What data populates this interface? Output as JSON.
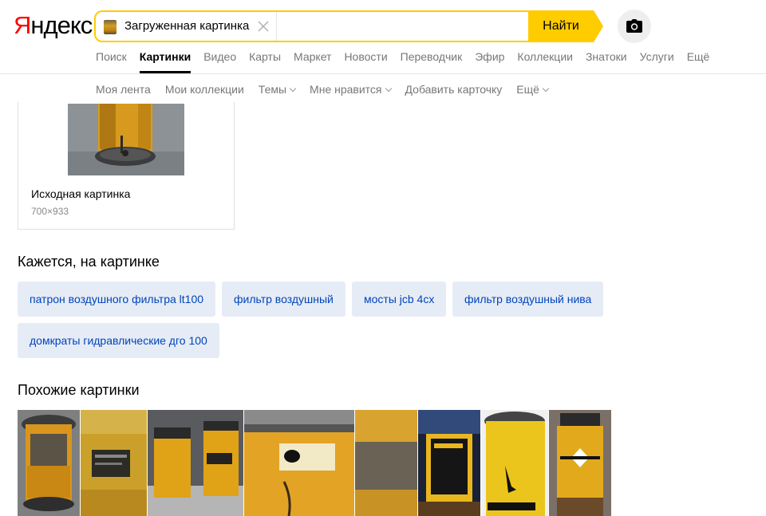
{
  "header": {
    "logo_first": "Я",
    "logo_rest": "ндекс",
    "search_chip": "Загруженная картинка",
    "search_placeholder": "",
    "find_button": "Найти"
  },
  "nav": {
    "tabs": [
      {
        "label": "Поиск",
        "active": false
      },
      {
        "label": "Картинки",
        "active": true
      },
      {
        "label": "Видео",
        "active": false
      },
      {
        "label": "Карты",
        "active": false
      },
      {
        "label": "Маркет",
        "active": false
      },
      {
        "label": "Новости",
        "active": false
      },
      {
        "label": "Переводчик",
        "active": false
      },
      {
        "label": "Эфир",
        "active": false
      },
      {
        "label": "Коллекции",
        "active": false
      },
      {
        "label": "Знатоки",
        "active": false
      },
      {
        "label": "Услуги",
        "active": false
      },
      {
        "label": "Ещё",
        "active": false
      }
    ]
  },
  "subnav": {
    "items": [
      {
        "label": "Моя лента",
        "dropdown": false
      },
      {
        "label": "Мои коллекции",
        "dropdown": false
      },
      {
        "label": "Темы",
        "dropdown": true
      },
      {
        "label": "Мне нравится",
        "dropdown": true
      },
      {
        "label": "Добавить карточку",
        "dropdown": false
      },
      {
        "label": "Ещё",
        "dropdown": true
      }
    ]
  },
  "original": {
    "title": "Исходная картинка",
    "size": "700×933"
  },
  "tags_section": {
    "title": "Кажется, на картинке",
    "tags": [
      "патрон воздушного фильтра lt100",
      "фильтр воздушный",
      "мосты jcb 4cx",
      "фильтр воздушный нива",
      "домкраты гидравлические дго 100"
    ]
  },
  "similar_section": {
    "title": "Похожие картинки",
    "images": [
      {
        "icon": "filter-yellow"
      },
      {
        "icon": "filter-label"
      },
      {
        "icon": "filter-pair"
      },
      {
        "icon": "filter-closeup"
      },
      {
        "icon": "filter-worn"
      },
      {
        "icon": "filter-dewalt"
      },
      {
        "icon": "filter-emu"
      },
      {
        "icon": "filter-cedima"
      }
    ]
  },
  "colors": {
    "accent": "#ffcc00",
    "brand_red": "#ff0000",
    "tag_bg": "#e6ecf6",
    "tag_text": "#0044bb"
  }
}
